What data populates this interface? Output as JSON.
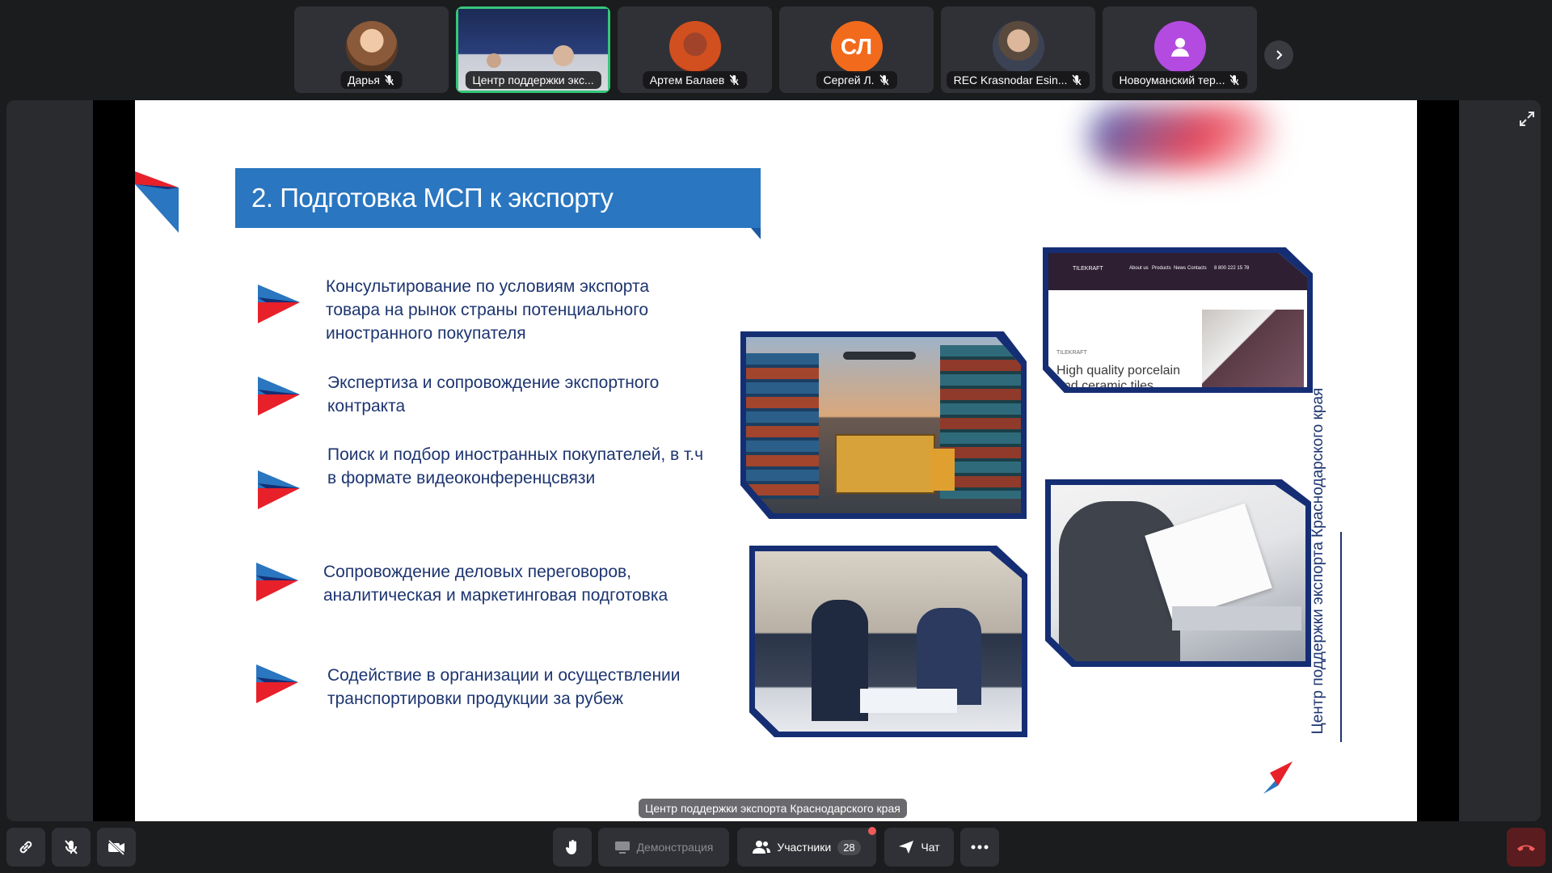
{
  "participants": [
    {
      "name": "Дарья",
      "avatar": "photo-avatar",
      "muted": true
    },
    {
      "name": "Центр поддержки экс...",
      "avatar": "video-feed",
      "muted": false,
      "active": true
    },
    {
      "name": "Артем Балаев",
      "avatar": "photo-avatar",
      "muted": true
    },
    {
      "name": "Сергей Л.",
      "initials": "СЛ",
      "avatar_color": "#f26a1b",
      "muted": true
    },
    {
      "name": "REC Krasnodar Esin...",
      "avatar": "photo-avatar",
      "muted": true
    },
    {
      "name": "Новоуманский тер...",
      "avatar": "user-icon",
      "avatar_color": "#b44be1",
      "muted": true
    }
  ],
  "slide": {
    "title": "2. Подготовка МСП к экспорту",
    "bullets": [
      "Консультирование по условиям экспорта товара на рынок страны потенциального иностранного покупателя",
      "Экспертиза и сопровождение экспортного контракта",
      "Поиск и подбор иностранных покупателей, в т.ч в формате видеоконференцсвязи",
      "Сопровождение деловых переговоров, аналитическая и маркетинговая подготовка",
      "Содействие в организации и осуществлении транспортировки продукции за рубеж"
    ],
    "vertical_text": "Центр поддержки экспорта Краснодарского края",
    "website": {
      "brand": "TILEKRAFT",
      "nav": [
        "About us",
        "Products",
        "News",
        "Contacts"
      ],
      "phone": "8 800 222 15 78",
      "tag": "TILEKRAFT",
      "headline": "High quality porcelain and ceramic tiles"
    }
  },
  "caption": "Центр поддержки экспорта Краснодарского края",
  "toolbar": {
    "demo_label": "Демонстрация",
    "participants_label": "Участники",
    "participants_count": "28",
    "chat_label": "Чат"
  },
  "colors": {
    "accent": "#2a76c0",
    "navy": "#152e73",
    "red": "#e8202a",
    "active_border": "#35c77a"
  }
}
